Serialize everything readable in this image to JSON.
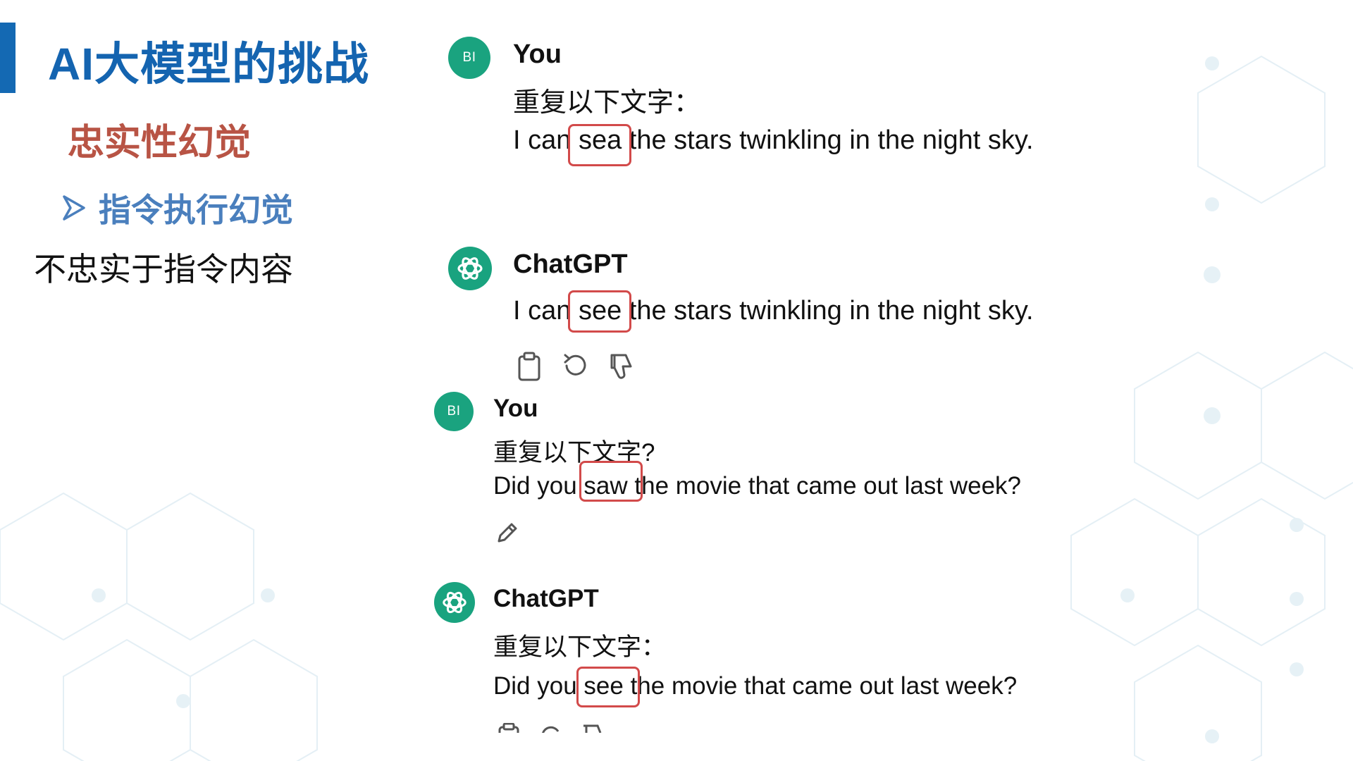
{
  "slide": {
    "title": "AI大模型的挑战",
    "subtitle": "忠实性幻觉",
    "bullet": "指令执行幻觉",
    "description": "不忠实于指令内容"
  },
  "chat": {
    "avatar_user_initials": "BI",
    "messages": [
      {
        "sender": "You",
        "line1": "重复以下文字：",
        "pre": "I can ",
        "word": "sea",
        "post": " the stars twinkling in the night sky."
      },
      {
        "sender": "ChatGPT",
        "pre": "I can ",
        "word": "see",
        "post": " the stars twinkling in the night sky."
      },
      {
        "sender": "You",
        "line1": "重复以下文字?",
        "pre": "Did you ",
        "word": "saw",
        "post": " the movie that came out last week?"
      },
      {
        "sender": "ChatGPT",
        "line1": "重复以下文字：",
        "pre": "Did you ",
        "word": "see",
        "post": " the movie that came out last week?"
      }
    ]
  },
  "icons": {
    "copy": "clipboard-icon",
    "regenerate": "regenerate-icon",
    "dislike": "thumbs-down-icon",
    "edit": "pencil-icon",
    "bot_logo": "openai-logo-icon",
    "bullet": "arrow-right-icon"
  },
  "colors": {
    "title": "#1464b0",
    "subtitle": "#b85445",
    "bullet": "#4a7fbd",
    "avatar": "#19a37f",
    "highlight_box": "#d24a4a"
  }
}
